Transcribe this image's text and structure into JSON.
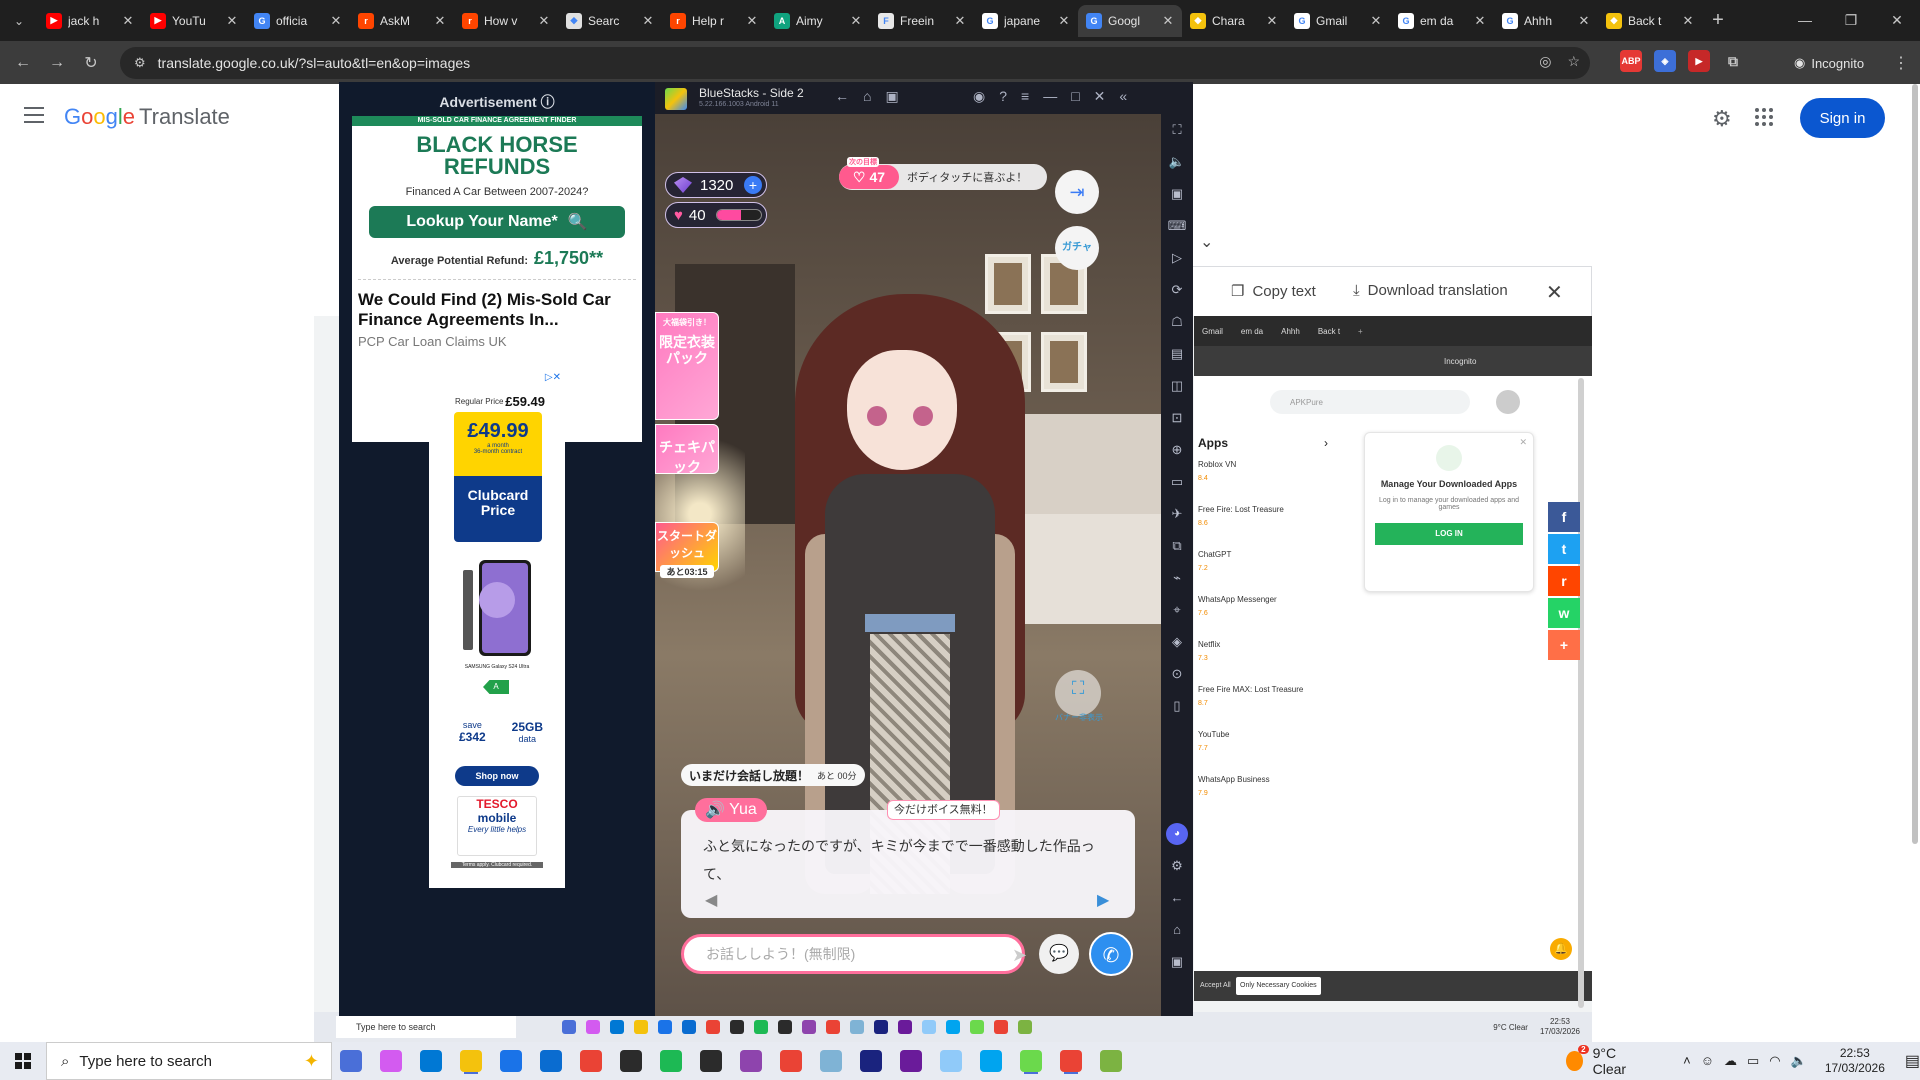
{
  "browser": {
    "tabs": [
      {
        "title": "jack h",
        "color": "#ff0000",
        "glyph": "▶"
      },
      {
        "title": "YouTu",
        "color": "#ff0000",
        "glyph": "▶"
      },
      {
        "title": "officia",
        "color": "#4285f4",
        "glyph": "G"
      },
      {
        "title": "AskM",
        "color": "#ff4500",
        "glyph": "r"
      },
      {
        "title": "How v",
        "color": "#ff4500",
        "glyph": "r"
      },
      {
        "title": "Searc",
        "color": "#e0e0e0",
        "glyph": "◆"
      },
      {
        "title": "Help r",
        "color": "#ff4500",
        "glyph": "r"
      },
      {
        "title": "Aimy",
        "color": "#10a37f",
        "glyph": "A"
      },
      {
        "title": "Freein",
        "color": "#e8e8e8",
        "glyph": "F"
      },
      {
        "title": "japane",
        "color": "#ffffff",
        "glyph": "G"
      },
      {
        "title": "Googl",
        "color": "#4285f4",
        "glyph": "G"
      },
      {
        "title": "Chara",
        "color": "#f4c20d",
        "glyph": "◆"
      },
      {
        "title": "Gmail",
        "color": "#ffffff",
        "glyph": "G"
      },
      {
        "title": "em da",
        "color": "#ffffff",
        "glyph": "G"
      },
      {
        "title": "Ahhh",
        "color": "#ffffff",
        "glyph": "G"
      },
      {
        "title": "Back t",
        "color": "#f4c20d",
        "glyph": "◆"
      }
    ],
    "active_tab_index": 10,
    "url": "translate.google.co.uk/?sl=auto&tl=en&op=images",
    "incognito_label": "Incognito",
    "new_tab": "+",
    "back": "←",
    "forward": "→",
    "reload": "↻"
  },
  "translate": {
    "logo_letters": [
      "G",
      "o",
      "o",
      "g",
      "l",
      "e"
    ],
    "product": "Translate",
    "sign_in": "Sign in",
    "copy_text": "Copy text",
    "download_translation": "Download translation"
  },
  "nested_screenshot": {
    "tabs": [
      "Gmail",
      "em da",
      "Ahhh",
      "Back t"
    ],
    "search_placeholder": "APKPure",
    "apps_heading": "Apps",
    "apps": [
      {
        "name": "Roblox VN",
        "rating": "8.4"
      },
      {
        "name": "Free Fire: Lost Treasure",
        "rating": "8.6"
      },
      {
        "name": "ChatGPT",
        "rating": "7.2"
      },
      {
        "name": "WhatsApp Messenger",
        "rating": "7.6"
      },
      {
        "name": "Netflix",
        "rating": "7.3"
      },
      {
        "name": "Free Fire MAX: Lost Treasure",
        "rating": "8.7"
      },
      {
        "name": "YouTube",
        "rating": "7.7"
      },
      {
        "name": "WhatsApp Business",
        "rating": "7.9"
      }
    ],
    "manage_title": "Manage Your Downloaded Apps",
    "manage_sub": "Log in to manage your downloaded apps and games",
    "login_btn": "LOG IN",
    "accept_all": "Accept All",
    "only_necessary": "Only Necessary Cookies",
    "incognito": "Incognito",
    "taskbar_search": "Type here to search",
    "weather": "9°C  Clear",
    "time": "22:53",
    "date": "17/03/2026"
  },
  "social": [
    {
      "name": "facebook",
      "color": "#3b5998",
      "glyph": "f"
    },
    {
      "name": "twitter",
      "color": "#1da1f2",
      "glyph": "t"
    },
    {
      "name": "reddit",
      "color": "#ff4500",
      "glyph": "r"
    },
    {
      "name": "whatsapp",
      "color": "#25d366",
      "glyph": "w"
    },
    {
      "name": "more",
      "color": "#ff6f47",
      "glyph": "+"
    }
  ],
  "ad": {
    "header": "Advertisement ⓘ",
    "ad1_top": "MIS-SOLD CAR FINANCE AGREEMENT FINDER",
    "ad1_title_1": "BLACK HORSE",
    "ad1_title_2": "REFUNDS",
    "ad1_sub": "Financed A Car Between 2007-2024?",
    "ad1_btn": "Lookup Your Name*",
    "ad1_refund_label": "Average Potential Refund:",
    "ad1_refund_value": "£1,750**",
    "ad1_headline": "We Could Find (2) Mis-Sold Car Finance Agreements In...",
    "ad1_source": "PCP Car Loan Claims UK",
    "ad2_regular": "Regular Price",
    "ad2_regular_price": "£59.49",
    "ad2_price": "£49.99",
    "ad2_price_sub1": "a month",
    "ad2_price_sub2": "36-month contract",
    "ad2_clubcard_1": "Clubcard",
    "ad2_clubcard_2": "Price",
    "ad2_phone_caption": "SAMSUNG Galaxy S24 Ultra",
    "ad2_energy": "A",
    "ad2_save_label": "save",
    "ad2_save_value": "£342",
    "ad2_data_value": "25GB",
    "ad2_data_label": "data",
    "ad2_shop": "Shop now",
    "ad2_tesco_1": "TESCO",
    "ad2_tesco_2": "mobile",
    "ad2_tesco_slogan": "Every little helps",
    "ad2_terms": "Terms apply. Clubcard required."
  },
  "bluestacks": {
    "title": "BlueStacks - Side 2",
    "version": "5.22.166.1003  Android 11"
  },
  "game": {
    "gems": "1320",
    "hearts": "40",
    "heart_bar_fraction": 0.55,
    "goal_label": "次の目標",
    "goal_value": "47",
    "goal_text": "ボディタッチに喜ぶよ！",
    "gacha_label": "ガチャ",
    "banner_1": "大福袋引き！",
    "banner_1b": "限定衣装パック",
    "banner_2": "チェキパック",
    "banner_3": "スタートダッシュ",
    "banner_3_time": "あと03:15",
    "fullscreen_label": "バナー非表示",
    "talk_free": "いまだけ会話し放題！",
    "talk_free_time": "あと 00分",
    "speaker": "Yua",
    "voice_free": "今だけボイス無料！",
    "dialogue": "ふと気になったのですが、キミが今までで一番感動した作品って、",
    "input_placeholder": "お話ししよう！(無制限)"
  },
  "taskbar": {
    "search": "Type here to search",
    "weather": "9°C  Clear",
    "weather_badge": "2",
    "time": "22:53",
    "date": "17/03/2026",
    "notif_badge": "2",
    "apps": [
      "#4a6fd8",
      "#d35bf0",
      "#0078d4",
      "#f4c20d",
      "#1a73e8",
      "#0a6cd0",
      "#ea4335",
      "#2b2b2b",
      "#1db954",
      "#2b2b2b",
      "#8e44ad",
      "#ea4335",
      "#7fb3d5",
      "#1a237e",
      "#6a1b9a",
      "#90caf9",
      "#00a4ef",
      "#6bd94c",
      "#ea4335",
      "#7cb342"
    ]
  }
}
